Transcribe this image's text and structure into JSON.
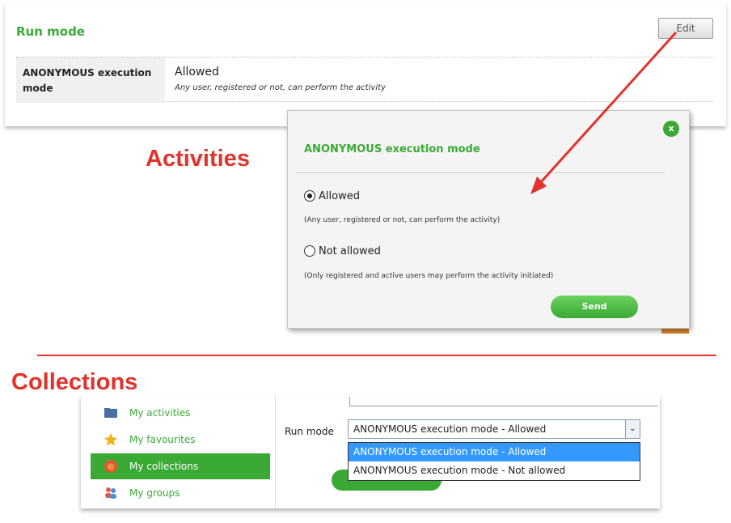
{
  "run_mode_panel": {
    "title": "Run mode",
    "edit_label": "Edit",
    "row_label": "ANONYMOUS execution mode",
    "row_value": "Allowed",
    "row_description": "Any user, registered or not, can perform the activity"
  },
  "headings": {
    "activities": "Activities",
    "collections": "Collections"
  },
  "modal": {
    "close_label": "x",
    "title": "ANONYMOUS execution mode",
    "options": [
      {
        "label": "Allowed",
        "description": "(Any user, registered or not, can perform the activity)",
        "checked": true
      },
      {
        "label": "Not allowed",
        "description": "(Only registered and active users may perform the activity initiated)",
        "checked": false
      }
    ],
    "send_label": "Send"
  },
  "sidebar": {
    "items": [
      {
        "label": "My activities",
        "icon": "folder-icon",
        "active": false
      },
      {
        "label": "My favourites",
        "icon": "star-icon",
        "active": false
      },
      {
        "label": "My collections",
        "icon": "box-icon",
        "active": true
      },
      {
        "label": "My groups",
        "icon": "users-icon",
        "active": false
      }
    ]
  },
  "run_mode_form": {
    "label": "Run mode",
    "selected_value": "ANONYMOUS execution mode - Allowed",
    "options": [
      "ANONYMOUS execution mode - Allowed",
      "ANONYMOUS execution mode - Not allowed"
    ]
  },
  "colors": {
    "accent_green": "#3aaa35",
    "heading_red": "#e1332b",
    "select_highlight": "#3399ff"
  }
}
